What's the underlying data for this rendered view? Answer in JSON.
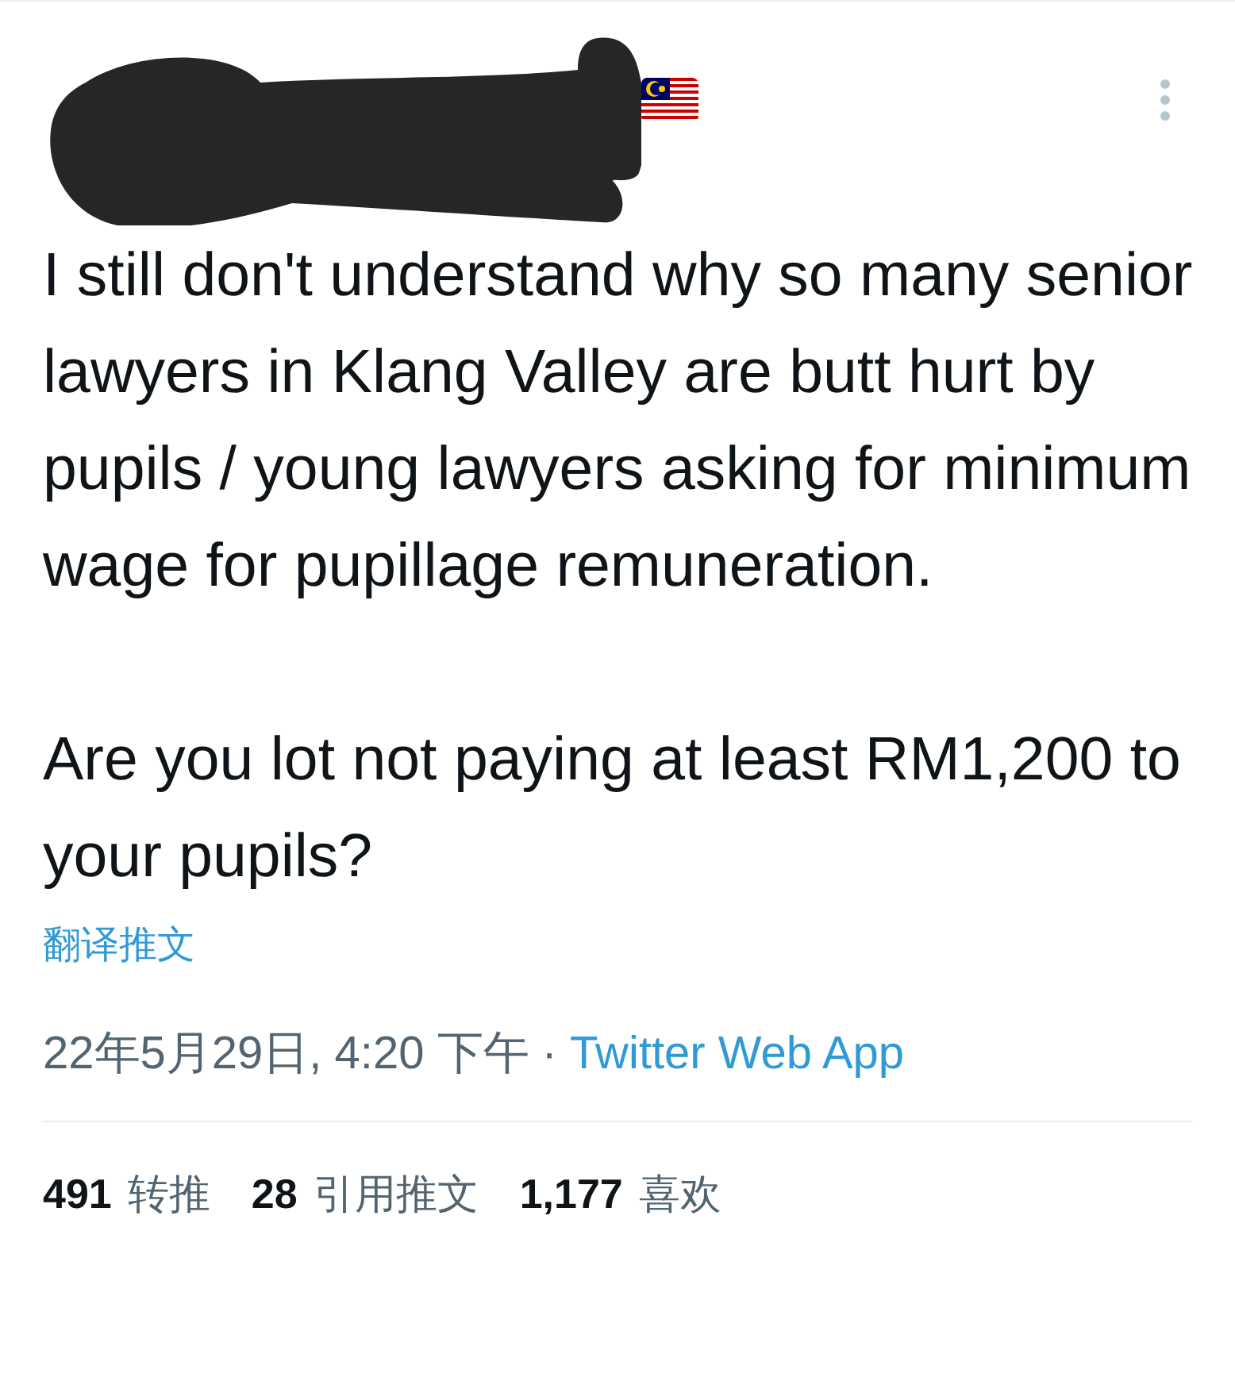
{
  "tweet": {
    "paragraphs": [
      "I still don't understand why so many senior lawyers in Klang Valley are butt hurt by pupils / young lawyers asking for minimum wage for pupillage remuneration.",
      "Are you lot not paying at least RM1,200 to your pupils?"
    ],
    "translate_link": "翻译推文",
    "timestamp": "22年5月29日, 4:20 下午",
    "separator": "·",
    "source": "Twitter Web App",
    "stats": [
      {
        "count": "491",
        "label": "转推"
      },
      {
        "count": "28",
        "label": "引用推文"
      },
      {
        "count": "1,177",
        "label": "喜欢"
      }
    ]
  }
}
